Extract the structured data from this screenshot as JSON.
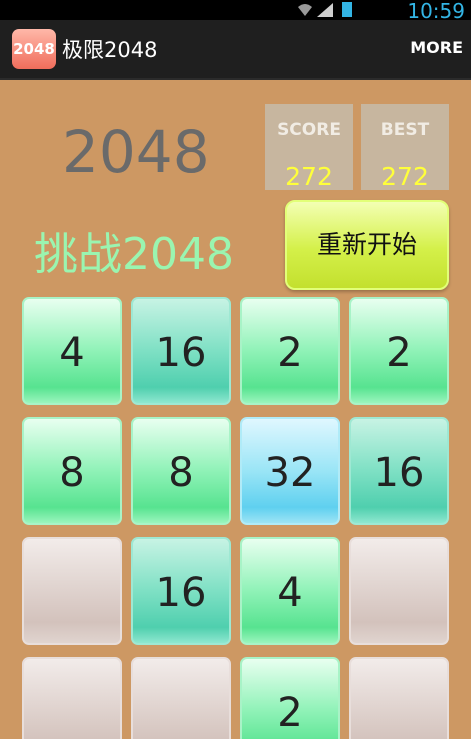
{
  "status_bar": {
    "time": "10:59"
  },
  "app_bar": {
    "icon_text": "2048",
    "title": "极限2048",
    "more_label": "MORE"
  },
  "game": {
    "logo": "2048",
    "score": {
      "label": "SCORE",
      "value": "272"
    },
    "best": {
      "label": "BEST",
      "value": "272"
    },
    "challenge_text": "挑战2048",
    "restart_label": "重新开始",
    "board": [
      [
        "4",
        "16",
        "2",
        "2"
      ],
      [
        "8",
        "8",
        "32",
        "16"
      ],
      [
        "",
        "16",
        "4",
        ""
      ],
      [
        "",
        "",
        "2",
        ""
      ]
    ]
  },
  "colors": {
    "board_bg": "#cd9863",
    "score_value": "#ffff3a",
    "challenge_text": "#9af5b0",
    "time": "#33b5e5"
  },
  "icons": [
    "wifi-icon",
    "signal-icon",
    "battery-icon"
  ]
}
